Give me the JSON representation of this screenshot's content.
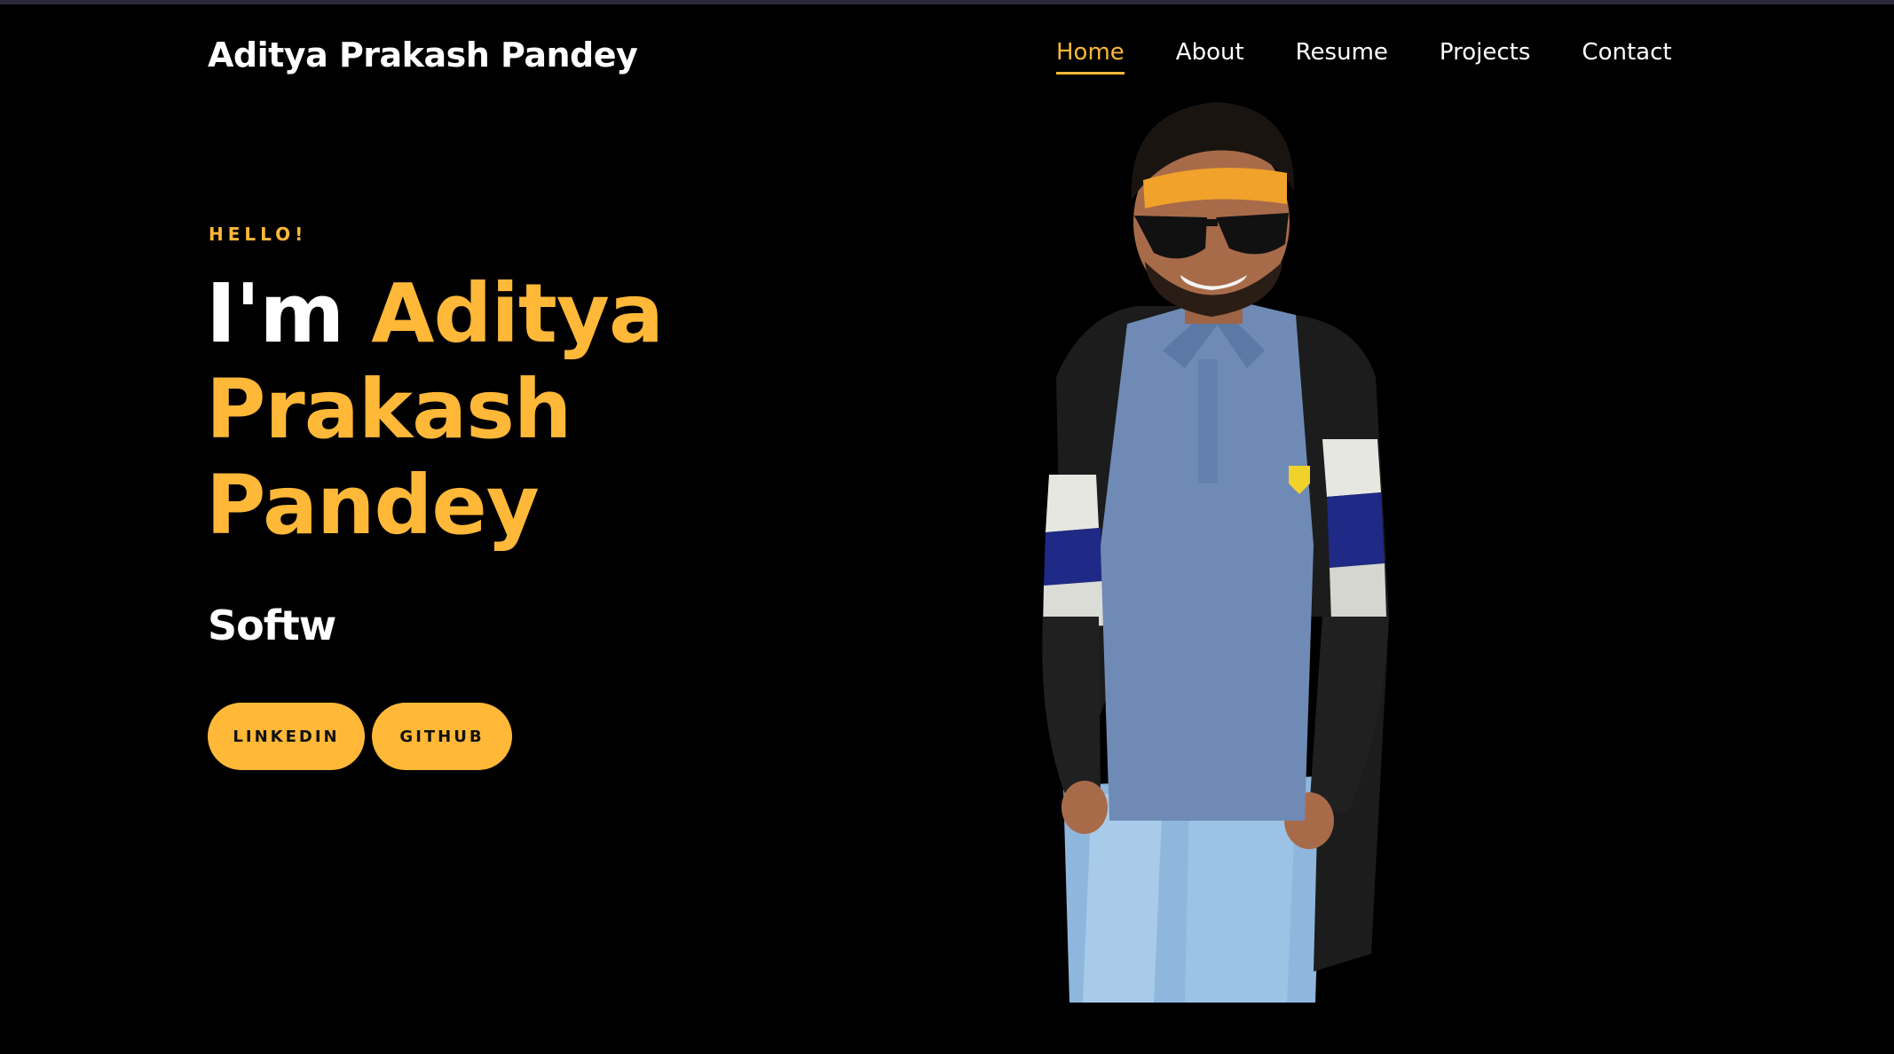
{
  "header": {
    "brand": "Aditya Prakash Pandey",
    "nav": [
      {
        "label": "Home",
        "active": true
      },
      {
        "label": "About",
        "active": false
      },
      {
        "label": "Resume",
        "active": false
      },
      {
        "label": "Projects",
        "active": false
      },
      {
        "label": "Contact",
        "active": false
      }
    ]
  },
  "hero": {
    "greeting": "HELLO!",
    "title_prefix": "I'm",
    "title_name": "Aditya Prakash Pandey",
    "role_typed": "Softw",
    "buttons": {
      "linkedin": "LINKEDIN",
      "github": "GITHUB"
    }
  },
  "colors": {
    "accent": "#ffb838",
    "background": "#000000",
    "text": "#ffffff"
  },
  "portrait": {
    "icon": "person-photo"
  }
}
